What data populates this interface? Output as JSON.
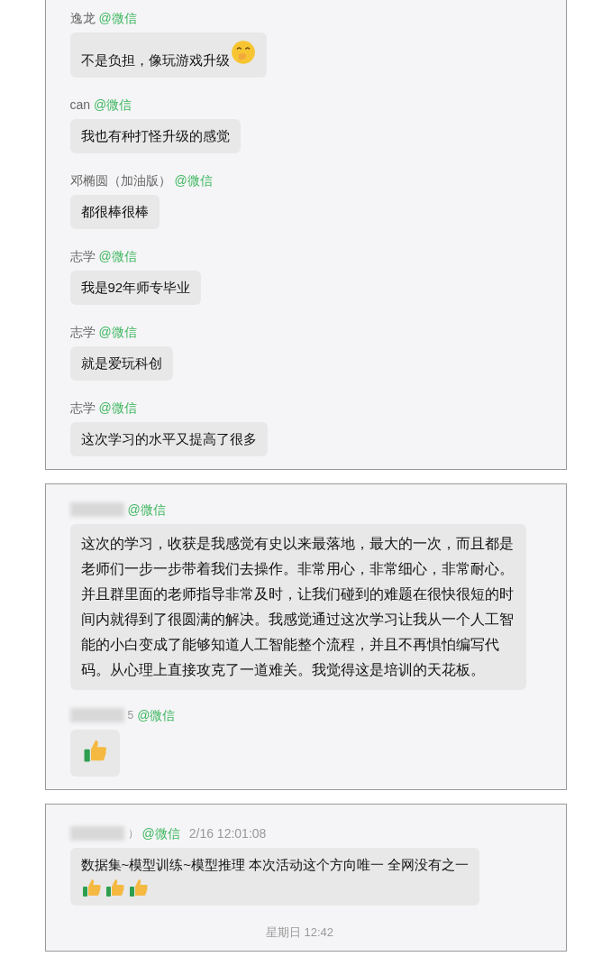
{
  "panels": [
    {
      "messages": [
        {
          "sender": "逸龙",
          "app": "@微信",
          "text": "不是负担，像玩游戏升级",
          "emoji": [
            {
              "kind": "hand-over-mouth"
            }
          ]
        },
        {
          "sender": "can",
          "app": "@微信",
          "text": "我也有种打怪升级的感觉"
        },
        {
          "sender": "邓椭圆（加油版）",
          "app": "@微信",
          "text": "都很棒很棒"
        },
        {
          "sender": "志学",
          "app": "@微信",
          "text": "我是92年师专毕业"
        },
        {
          "sender": "志学",
          "app": "@微信",
          "text": "就是爱玩科创"
        },
        {
          "sender": "志学",
          "app": "@微信",
          "text": "这次学习的水平又提高了很多"
        }
      ]
    },
    {
      "messages": [
        {
          "blurred": true,
          "app": "@微信",
          "text": "这次的学习，收获是我感觉有史以来最落地，最大的一次，而且都是老师们一步一步带着我们去操作。非常用心，非常细心，非常耐心。并且群里面的老师指导非常及时，让我们碰到的难题在很快很短的时间内就得到了很圆满的解决。我感觉通过这次学习让我从一个人工智能的小白变成了能够知道人工智能整个流程，并且不再惧怕编写代码。从心理上直接攻克了一道难关。我觉得这是培训的天花板。"
        },
        {
          "blurred": true,
          "sender": "5",
          "app": "@微信",
          "emoji": [
            {
              "kind": "thumbs-up"
            }
          ]
        }
      ]
    },
    {
      "messages": [
        {
          "blurred": true,
          "sender": "）",
          "app": "@微信",
          "time": "2/16 12:01:08",
          "text": "数据集~模型训练~模型推理 本次活动这个方向唯一 全网没有之一",
          "emoji": [
            {
              "kind": "thumbs-up"
            },
            {
              "kind": "thumbs-up"
            },
            {
              "kind": "thumbs-up"
            }
          ]
        }
      ],
      "footer": "星期日 12:42"
    }
  ]
}
